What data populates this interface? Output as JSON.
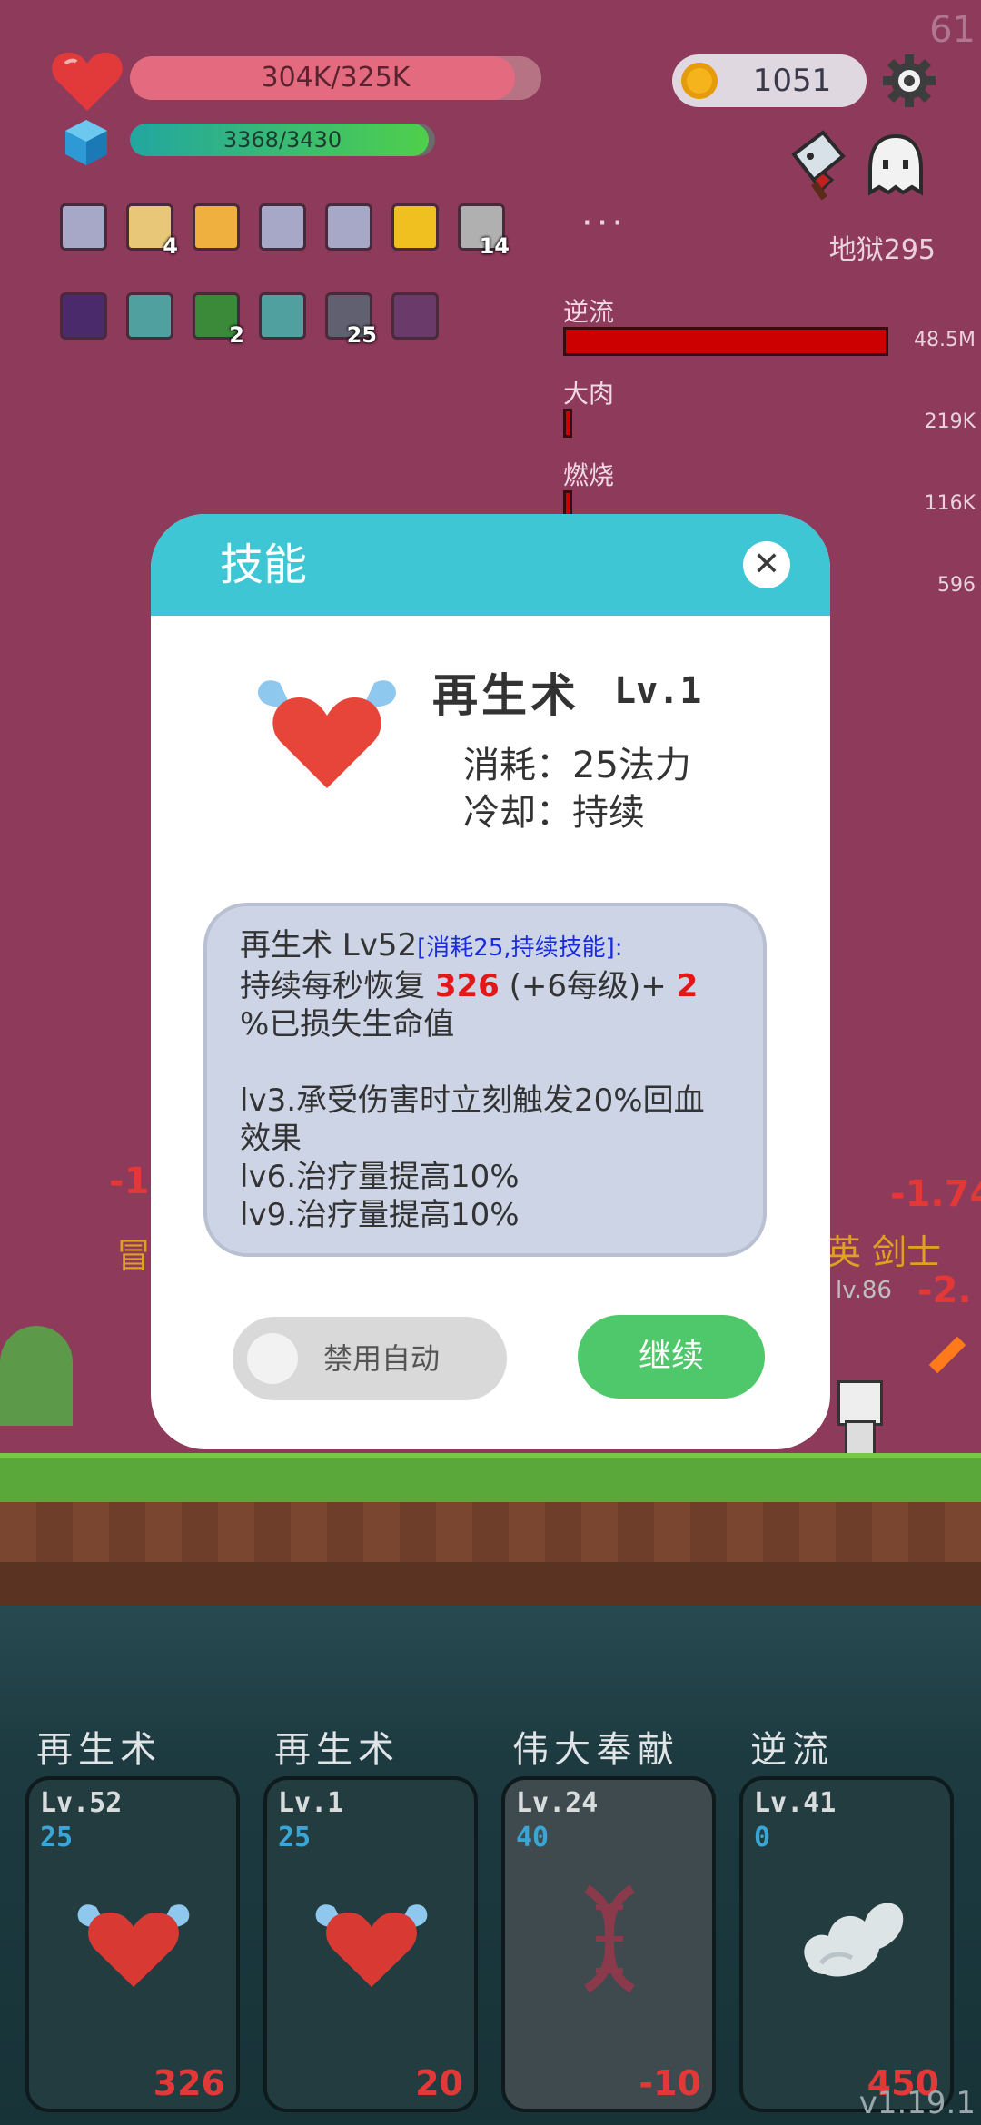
{
  "fps": "61",
  "hud": {
    "hp_text": "304K/325K",
    "hp_fraction": 0.935,
    "mp_text": "3368/3430",
    "mp_fraction": 0.98,
    "coins": "1051",
    "dungeon": "地狱295",
    "more": "···"
  },
  "buffs_row1": [
    {
      "icon": "scroll-ribbon-icon",
      "count": ""
    },
    {
      "icon": "parchment-icon",
      "count": "4"
    },
    {
      "icon": "map-icon",
      "count": ""
    },
    {
      "icon": "scroll-ribbon-icon",
      "count": ""
    },
    {
      "icon": "scroll-ribbon-icon",
      "count": ""
    },
    {
      "icon": "crown-icon",
      "count": ""
    },
    {
      "icon": "meteor-icon",
      "count": "14"
    }
  ],
  "buffs_row2": [
    {
      "icon": "demon-icon",
      "count": ""
    },
    {
      "icon": "light-icon",
      "count": ""
    },
    {
      "icon": "sword-green-icon",
      "count": "2"
    },
    {
      "icon": "light-icon",
      "count": ""
    },
    {
      "icon": "blade-icon",
      "count": "25"
    },
    {
      "icon": "mask-icon",
      "count": ""
    }
  ],
  "damage_stats": [
    {
      "label": "逆流",
      "value": "48.5M",
      "fraction": 1.0
    },
    {
      "label": "大肉",
      "value": "219K",
      "fraction": 0.02
    },
    {
      "label": "燃烧",
      "value": "116K",
      "fraction": 0.01
    },
    {
      "label": "",
      "value": "596",
      "fraction": 0.0
    }
  ],
  "scene": {
    "left_dmg": "-1",
    "left_name": "冒",
    "right_dmg": "-1.74",
    "right_name": "英 剑士",
    "right_lv": "lv.86",
    "right_dmg2": "-2."
  },
  "modal": {
    "title": "技能",
    "close": "✕",
    "skill_name": "再生术",
    "skill_level": "Lv.1",
    "cost": "消耗：25法力",
    "cooldown": "冷却：持续",
    "desc_head": "再生术 Lv52",
    "desc_meta": "[消耗25,持续技能]:",
    "desc_line1a": "持续每秒恢复",
    "desc_val1": "326",
    "desc_line1b": "(+6每级)+",
    "desc_val2": "2",
    "desc_line2": "%已损失生命值",
    "desc_lv3": "lv3.承受伤害时立刻触发20%回血效果",
    "desc_lv6": "lv6.治疗量提高10%",
    "desc_lv9": "lv9.治疗量提高10%",
    "toggle_label": "禁用自动",
    "continue_label": "继续"
  },
  "cards": [
    {
      "title": "再生术",
      "level": "Lv.52",
      "cost": "25",
      "value": "326",
      "icon": "winged-heart-icon",
      "dim": false
    },
    {
      "title": "再生术",
      "level": "Lv.1",
      "cost": "25",
      "value": "20",
      "icon": "winged-heart-icon",
      "dim": false
    },
    {
      "title": "伟大奉献",
      "level": "Lv.24",
      "cost": "40",
      "value": "-10",
      "icon": "dna-icon",
      "dim": true
    },
    {
      "title": "逆流",
      "level": "Lv.41",
      "cost": "0",
      "value": "450",
      "icon": "cloud-wing-icon",
      "dim": false
    }
  ],
  "version": "v1.19.1",
  "colors": {
    "background": "#8e3a5a",
    "modal_header": "#3ec6d4",
    "continue": "#4ec86a"
  }
}
